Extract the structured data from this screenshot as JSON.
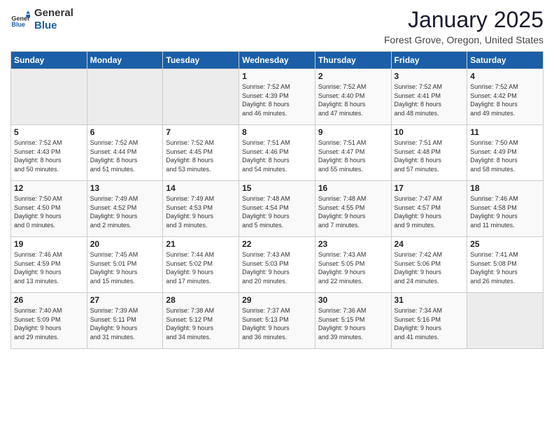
{
  "header": {
    "logo_general": "General",
    "logo_blue": "Blue",
    "month_title": "January 2025",
    "location": "Forest Grove, Oregon, United States"
  },
  "days_of_week": [
    "Sunday",
    "Monday",
    "Tuesday",
    "Wednesday",
    "Thursday",
    "Friday",
    "Saturday"
  ],
  "weeks": [
    [
      {
        "day": "",
        "info": ""
      },
      {
        "day": "",
        "info": ""
      },
      {
        "day": "",
        "info": ""
      },
      {
        "day": "1",
        "info": "Sunrise: 7:52 AM\nSunset: 4:39 PM\nDaylight: 8 hours\nand 46 minutes."
      },
      {
        "day": "2",
        "info": "Sunrise: 7:52 AM\nSunset: 4:40 PM\nDaylight: 8 hours\nand 47 minutes."
      },
      {
        "day": "3",
        "info": "Sunrise: 7:52 AM\nSunset: 4:41 PM\nDaylight: 8 hours\nand 48 minutes."
      },
      {
        "day": "4",
        "info": "Sunrise: 7:52 AM\nSunset: 4:42 PM\nDaylight: 8 hours\nand 49 minutes."
      }
    ],
    [
      {
        "day": "5",
        "info": "Sunrise: 7:52 AM\nSunset: 4:43 PM\nDaylight: 8 hours\nand 50 minutes."
      },
      {
        "day": "6",
        "info": "Sunrise: 7:52 AM\nSunset: 4:44 PM\nDaylight: 8 hours\nand 51 minutes."
      },
      {
        "day": "7",
        "info": "Sunrise: 7:52 AM\nSunset: 4:45 PM\nDaylight: 8 hours\nand 53 minutes."
      },
      {
        "day": "8",
        "info": "Sunrise: 7:51 AM\nSunset: 4:46 PM\nDaylight: 8 hours\nand 54 minutes."
      },
      {
        "day": "9",
        "info": "Sunrise: 7:51 AM\nSunset: 4:47 PM\nDaylight: 8 hours\nand 55 minutes."
      },
      {
        "day": "10",
        "info": "Sunrise: 7:51 AM\nSunset: 4:48 PM\nDaylight: 8 hours\nand 57 minutes."
      },
      {
        "day": "11",
        "info": "Sunrise: 7:50 AM\nSunset: 4:49 PM\nDaylight: 8 hours\nand 58 minutes."
      }
    ],
    [
      {
        "day": "12",
        "info": "Sunrise: 7:50 AM\nSunset: 4:50 PM\nDaylight: 9 hours\nand 0 minutes."
      },
      {
        "day": "13",
        "info": "Sunrise: 7:49 AM\nSunset: 4:52 PM\nDaylight: 9 hours\nand 2 minutes."
      },
      {
        "day": "14",
        "info": "Sunrise: 7:49 AM\nSunset: 4:53 PM\nDaylight: 9 hours\nand 3 minutes."
      },
      {
        "day": "15",
        "info": "Sunrise: 7:48 AM\nSunset: 4:54 PM\nDaylight: 9 hours\nand 5 minutes."
      },
      {
        "day": "16",
        "info": "Sunrise: 7:48 AM\nSunset: 4:55 PM\nDaylight: 9 hours\nand 7 minutes."
      },
      {
        "day": "17",
        "info": "Sunrise: 7:47 AM\nSunset: 4:57 PM\nDaylight: 9 hours\nand 9 minutes."
      },
      {
        "day": "18",
        "info": "Sunrise: 7:46 AM\nSunset: 4:58 PM\nDaylight: 9 hours\nand 11 minutes."
      }
    ],
    [
      {
        "day": "19",
        "info": "Sunrise: 7:46 AM\nSunset: 4:59 PM\nDaylight: 9 hours\nand 13 minutes."
      },
      {
        "day": "20",
        "info": "Sunrise: 7:45 AM\nSunset: 5:01 PM\nDaylight: 9 hours\nand 15 minutes."
      },
      {
        "day": "21",
        "info": "Sunrise: 7:44 AM\nSunset: 5:02 PM\nDaylight: 9 hours\nand 17 minutes."
      },
      {
        "day": "22",
        "info": "Sunrise: 7:43 AM\nSunset: 5:03 PM\nDaylight: 9 hours\nand 20 minutes."
      },
      {
        "day": "23",
        "info": "Sunrise: 7:43 AM\nSunset: 5:05 PM\nDaylight: 9 hours\nand 22 minutes."
      },
      {
        "day": "24",
        "info": "Sunrise: 7:42 AM\nSunset: 5:06 PM\nDaylight: 9 hours\nand 24 minutes."
      },
      {
        "day": "25",
        "info": "Sunrise: 7:41 AM\nSunset: 5:08 PM\nDaylight: 9 hours\nand 26 minutes."
      }
    ],
    [
      {
        "day": "26",
        "info": "Sunrise: 7:40 AM\nSunset: 5:09 PM\nDaylight: 9 hours\nand 29 minutes."
      },
      {
        "day": "27",
        "info": "Sunrise: 7:39 AM\nSunset: 5:11 PM\nDaylight: 9 hours\nand 31 minutes."
      },
      {
        "day": "28",
        "info": "Sunrise: 7:38 AM\nSunset: 5:12 PM\nDaylight: 9 hours\nand 34 minutes."
      },
      {
        "day": "29",
        "info": "Sunrise: 7:37 AM\nSunset: 5:13 PM\nDaylight: 9 hours\nand 36 minutes."
      },
      {
        "day": "30",
        "info": "Sunrise: 7:36 AM\nSunset: 5:15 PM\nDaylight: 9 hours\nand 39 minutes."
      },
      {
        "day": "31",
        "info": "Sunrise: 7:34 AM\nSunset: 5:16 PM\nDaylight: 9 hours\nand 41 minutes."
      },
      {
        "day": "",
        "info": ""
      }
    ]
  ]
}
